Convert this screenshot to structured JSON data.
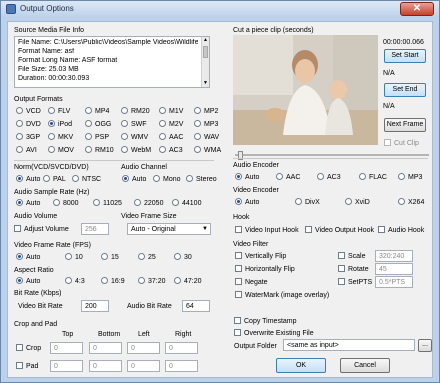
{
  "window": {
    "title": "Output Options",
    "close_label": "✕"
  },
  "source": {
    "header": "Source Media File Info",
    "lines": [
      "File Name: C:\\Users\\Public\\Videos\\Sample Videos\\Wildlife",
      "Format Name: asf",
      "Format Long Name: ASF format",
      "File Size: 25.03 MB",
      "Duration: 00:00:30.093"
    ]
  },
  "output_formats": {
    "header": "Output Formats",
    "rows": [
      [
        "VCD",
        "FLV",
        "MP4",
        "RM20",
        "M1V",
        "MP2"
      ],
      [
        "DVD",
        "iPod",
        "OGG",
        "SWF",
        "M2V",
        "MP3"
      ],
      [
        "3GP",
        "MKV",
        "PSP",
        "WMV",
        "AAC",
        "WAV"
      ],
      [
        "AVI",
        "MOV",
        "RM10",
        "WebM",
        "AC3",
        "WMA"
      ]
    ],
    "selected": "iPod"
  },
  "norm": {
    "header": "Norm(VCD/SVCD/DVD)",
    "options": [
      "Auto",
      "PAL",
      "NTSC"
    ],
    "selected": "Auto"
  },
  "audio_channel": {
    "header": "Audio Channel",
    "options": [
      "Auto",
      "Mono",
      "Stereo"
    ],
    "selected": "Auto"
  },
  "audio_sample_rate": {
    "header": "Audio Sample Rate (Hz)",
    "options": [
      "Auto",
      "8000",
      "11025",
      "22050",
      "44100"
    ],
    "selected": "Auto"
  },
  "audio_volume": {
    "header": "Audio Volume",
    "checkbox_label": "Adjust Volume",
    "value": "256"
  },
  "video_frame_size": {
    "header": "Video Frame Size",
    "value": "Auto - Original"
  },
  "video_frame_rate": {
    "header": "Video Frame Rate (FPS)",
    "options": [
      "Auto",
      "10",
      "15",
      "25",
      "30"
    ],
    "selected": "Auto"
  },
  "aspect_ratio": {
    "header": "Aspect Ratio",
    "options": [
      "Auto",
      "4:3",
      "16:9",
      "37:20",
      "47:20"
    ],
    "selected": "Auto"
  },
  "bit_rate": {
    "header": "Bit Rate (Kbps)",
    "video_label": "Video Bit Rate",
    "video_value": "200",
    "audio_label": "Audio Bit Rate",
    "audio_value": "64"
  },
  "crop_pad": {
    "header": "Crop and Pad",
    "columns": [
      "Top",
      "Bottom",
      "Left",
      "Right"
    ],
    "rows": [
      {
        "label": "Crop",
        "values": [
          "0",
          "0",
          "0",
          "0"
        ]
      },
      {
        "label": "Pad",
        "values": [
          "0",
          "0",
          "0",
          "0"
        ]
      }
    ]
  },
  "clip": {
    "header": "Cut a piece clip (seconds)",
    "start_time": "00:00:00.066",
    "set_start": "Set Start",
    "start_value": "N/A",
    "set_end": "Set End",
    "end_value": "N/A",
    "next_frame": "Next Frame",
    "cut_clip": "Cut Clip"
  },
  "audio_encoder": {
    "header": "Audio Encoder",
    "options": [
      "Auto",
      "AAC",
      "AC3",
      "FLAC",
      "MP3"
    ],
    "selected": "Auto"
  },
  "video_encoder": {
    "header": "Video Encoder",
    "options": [
      "Auto",
      "DivX",
      "XviD",
      "X264"
    ],
    "selected": "Auto"
  },
  "hook": {
    "header": "Hook",
    "options": [
      "Video Input Hook",
      "Video Output Hook",
      "Audio Hook"
    ]
  },
  "video_filter": {
    "header": "Video Filter",
    "left": [
      "Vertically Flip",
      "Horizontally Flip",
      "Negate",
      "WaterMark (image overlay)"
    ],
    "right": [
      {
        "label": "Scale",
        "value": "320:240"
      },
      {
        "label": "Rotate",
        "value": "45"
      },
      {
        "label": "SetPTS",
        "value": "0.5*PTS"
      }
    ]
  },
  "misc": {
    "copy_timestamp": "Copy Timestamp",
    "overwrite": "Overwrite Existing File"
  },
  "output_folder": {
    "label": "Output Folder",
    "value": "<same as input>",
    "browse": "..."
  },
  "buttons": {
    "ok": "OK",
    "cancel": "Cancel"
  }
}
